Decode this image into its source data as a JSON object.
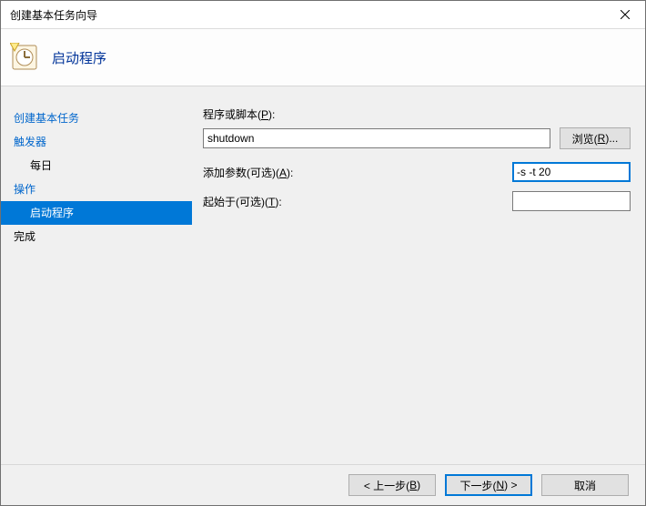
{
  "window": {
    "title": "创建基本任务向导"
  },
  "header": {
    "title": "启动程序"
  },
  "sidebar": {
    "items": [
      {
        "label": "创建基本任务",
        "link": true,
        "indent": false,
        "selected": false
      },
      {
        "label": "触发器",
        "link": true,
        "indent": false,
        "selected": false
      },
      {
        "label": "每日",
        "link": false,
        "indent": true,
        "selected": false
      },
      {
        "label": "操作",
        "link": true,
        "indent": false,
        "selected": false
      },
      {
        "label": "启动程序",
        "link": false,
        "indent": true,
        "selected": true
      },
      {
        "label": "完成",
        "link": false,
        "indent": false,
        "selected": false
      }
    ]
  },
  "form": {
    "program_label_prefix": "程序或脚本(",
    "program_label_u": "P",
    "program_label_suffix": "):",
    "program_value": "shutdown",
    "browse_prefix": "浏览(",
    "browse_u": "R",
    "browse_suffix": ")...",
    "args_label_prefix": "添加参数(可选)(",
    "args_label_u": "A",
    "args_label_suffix": "):",
    "args_value": "-s -t 20",
    "startin_label_prefix": "起始于(可选)(",
    "startin_label_u": "T",
    "startin_label_suffix": "):",
    "startin_value": ""
  },
  "footer": {
    "back_prefix": "< 上一步(",
    "back_u": "B",
    "back_suffix": ")",
    "next_prefix": "下一步(",
    "next_u": "N",
    "next_suffix": ") >",
    "cancel": "取消"
  }
}
